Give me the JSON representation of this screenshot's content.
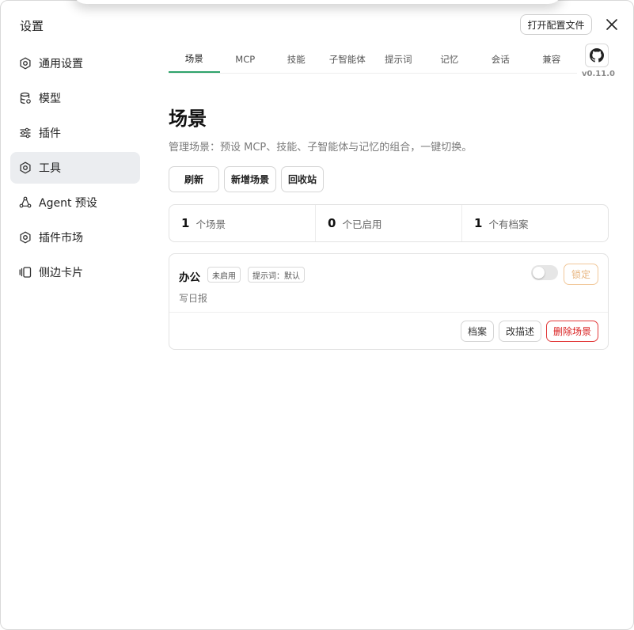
{
  "window": {
    "title": "设置",
    "open_config_label": "打开配置文件",
    "version": "v0.11.0"
  },
  "sidebar": {
    "items": [
      {
        "label": "通用设置",
        "icon": "gear-icon"
      },
      {
        "label": "模型",
        "icon": "database-icon"
      },
      {
        "label": "插件",
        "icon": "sliders-icon"
      },
      {
        "label": "工具",
        "icon": "gear-icon",
        "active": true
      },
      {
        "label": "Agent 预设",
        "icon": "agent-icon"
      },
      {
        "label": "插件市场",
        "icon": "gear-icon"
      },
      {
        "label": "侧边卡片",
        "icon": "cards-icon"
      }
    ]
  },
  "tabs": [
    {
      "label": "场景",
      "active": true
    },
    {
      "label": "MCP"
    },
    {
      "label": "技能"
    },
    {
      "label": "子智能体"
    },
    {
      "label": "提示词"
    },
    {
      "label": "记忆"
    },
    {
      "label": "会话"
    },
    {
      "label": "兼容"
    }
  ],
  "main": {
    "title": "场景",
    "description": "管理场景：预设 MCP、技能、子智能体与记忆的组合，一键切换。",
    "actions": {
      "refresh": "刷新",
      "add_scene": "新增场景",
      "recycle_bin": "回收站"
    },
    "stats": [
      {
        "value": "1",
        "label": "个场景"
      },
      {
        "value": "0",
        "label": "个已启用"
      },
      {
        "value": "1",
        "label": "个有档案"
      }
    ],
    "scenes": [
      {
        "name": "办公",
        "status_tag": "未启用",
        "prompt_tag": "提示词：默认",
        "description": "写日报",
        "enabled": false,
        "lock_label": "锁定",
        "archive_label": "档案",
        "edit_desc_label": "改描述",
        "delete_label": "删除场景"
      }
    ]
  },
  "colors": {
    "accent": "#2fa36b",
    "danger": "#d92020",
    "lock": "#e8b57f"
  }
}
